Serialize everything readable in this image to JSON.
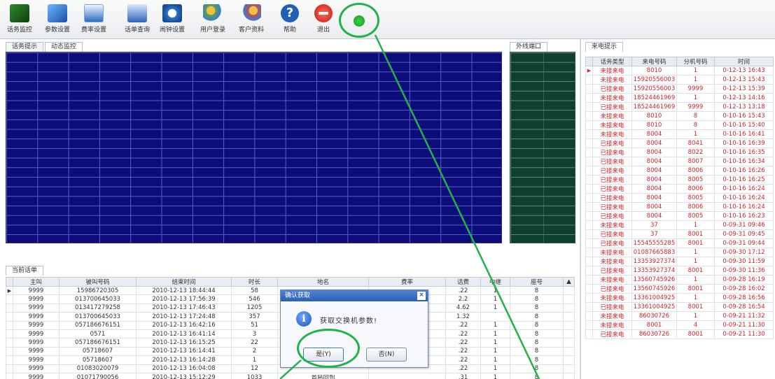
{
  "toolbar": {
    "items": [
      {
        "label": "话务监控",
        "icon": "monitor-icon"
      },
      {
        "label": "参数设置",
        "icon": "parameter-icon"
      },
      {
        "label": "费率设置",
        "icon": "rate-icon"
      },
      {
        "label": "话单查询",
        "icon": "query-icon"
      },
      {
        "label": "闹钟设置",
        "icon": "alarm-icon"
      },
      {
        "label": "用户登录",
        "icon": "user-login-icon"
      },
      {
        "label": "客户资料",
        "icon": "client-icon"
      },
      {
        "label": "帮助",
        "icon": "help-icon"
      },
      {
        "label": "退出",
        "icon": "exit-icon"
      }
    ]
  },
  "tabs": {
    "call_prompt": "话务提示",
    "dynamic_monitor": "动态监控",
    "outline": "外线端口",
    "incoming": "来电提示",
    "current_calls": "当前话单"
  },
  "call_table": {
    "headers": [
      "主叫",
      "被叫号码",
      "结束时间",
      "时长",
      "地名",
      "费率",
      "话费",
      "中继",
      "座号"
    ],
    "rows": [
      [
        "9999",
        "15986720305",
        "2010-12-13 18:44:44",
        "58",
        "",
        "",
        ".22",
        "1",
        "8"
      ],
      [
        "9999",
        "013700645033",
        "2010-12-13 17:56:39",
        "546",
        "",
        "",
        "2.2",
        "1",
        "8"
      ],
      [
        "9999",
        "013417279258",
        "2010-12-13 17:46:43",
        "1205",
        "",
        "",
        "4.62",
        "1",
        "8"
      ],
      [
        "9999",
        "013700645033",
        "2010-12-13 17:24:48",
        "357",
        "",
        "",
        "1.32",
        "",
        "8"
      ],
      [
        "9999",
        "057186676151",
        "2010-12-13 16:42:16",
        "51",
        "",
        "",
        ".22",
        "1",
        "8"
      ],
      [
        "9999",
        "0571",
        "2010-12-13 16:41:14",
        "3",
        "",
        "",
        ".22",
        "1",
        "8"
      ],
      [
        "9999",
        "057186676151",
        "2010-12-13 16:15:25",
        "22",
        "",
        "",
        ".22",
        "1",
        "8"
      ],
      [
        "9999",
        "05718607",
        "2010-12-13 16:14:41",
        "2",
        "",
        "",
        ".22",
        "1",
        "8"
      ],
      [
        "9999",
        "05718607",
        "2010-12-13 16:14:28",
        "1",
        "",
        "",
        ".22",
        "1",
        "8"
      ],
      [
        "9999",
        "01083020079",
        "2010-12-13 16:04:08",
        "12",
        "",
        "",
        ".22",
        "1",
        "8"
      ],
      [
        "9999",
        "01071790056",
        "2010-12-13 15:12:29",
        "1033",
        "首局回到",
        "",
        ".31",
        "1",
        "8"
      ]
    ]
  },
  "incoming": {
    "headers": [
      "话务类型",
      "来电号码",
      "分机号码",
      "时间"
    ],
    "rows": [
      [
        "未接来电",
        "8010",
        "1",
        "0-12-13 16:43"
      ],
      [
        "未接来电",
        "15920556003",
        "1",
        "0-12-13 15:43"
      ],
      [
        "已接来电",
        "15920556003",
        "9999",
        "0-12-13 15:39"
      ],
      [
        "未接来电",
        "18524461969",
        "1",
        "0-12-13 14:16"
      ],
      [
        "已接来电",
        "18524461969",
        "9999",
        "0-12-13 13:18"
      ],
      [
        "未接来电",
        "8010",
        "8",
        "0-10-16 15:43"
      ],
      [
        "未接来电",
        "8010",
        "8",
        "0-10-16 15:40"
      ],
      [
        "未接来电",
        "8004",
        "1",
        "0-10-16 16:41"
      ],
      [
        "已接来电",
        "8004",
        "8041",
        "0-10-16 16:39"
      ],
      [
        "已接来电",
        "8004",
        "8022",
        "0-10-16 16:35"
      ],
      [
        "已接来电",
        "8004",
        "8007",
        "0-10-16 16:34"
      ],
      [
        "已接来电",
        "8004",
        "8006",
        "0-10-16 16:26"
      ],
      [
        "已接来电",
        "8004",
        "8005",
        "0-10-16 16:25"
      ],
      [
        "已接来电",
        "8004",
        "8006",
        "0-10-16 16:24"
      ],
      [
        "已接来电",
        "8004",
        "8005",
        "0-10-16 16:24"
      ],
      [
        "已接来电",
        "8004",
        "8006",
        "0-10-16 16:24"
      ],
      [
        "已接来电",
        "8004",
        "8005",
        "0-10-16 16:23"
      ],
      [
        "未接来电",
        "37",
        "1",
        "0-09-31 09:46"
      ],
      [
        "已接来电",
        "37",
        "8001",
        "0-09-31 09:45"
      ],
      [
        "已接来电",
        "15545555285",
        "8001",
        "0-09-31 09:44"
      ],
      [
        "未接来电",
        "01087665883",
        "1",
        "0-09-30 17:12"
      ],
      [
        "未接来电",
        "13353927374",
        "1",
        "0-09-30 11:59"
      ],
      [
        "已接来电",
        "13353927374",
        "8001",
        "0-09-30 11:36"
      ],
      [
        "未接来电",
        "13560745926",
        "1",
        "0-09-28 16:19"
      ],
      [
        "已接来电",
        "13560745926",
        "8001",
        "0-09-28 16:02"
      ],
      [
        "未接来电",
        "13361004925",
        "1",
        "0-09-28 16:56"
      ],
      [
        "已接来电",
        "13361004925",
        "8001",
        "0-09-28 16:54"
      ],
      [
        "未接来电",
        "86030726",
        "1",
        "0-09-21 11:32"
      ],
      [
        "未接来电",
        "8001",
        "4",
        "0-09-21 11:30"
      ],
      [
        "已接来电",
        "86030726",
        "8001",
        "0-09-21 11:30"
      ]
    ]
  },
  "dialog": {
    "title": "确认获取",
    "message": "获取交换机参数!",
    "yes_label": "是(Y)",
    "no_label": "否(N)",
    "close": "×",
    "info_glyph": "i"
  },
  "colors": {
    "grid": "#0d0d7a",
    "outline": "#0f3f2f",
    "accent": "#21b24a",
    "missed_text": "#d2242a"
  }
}
